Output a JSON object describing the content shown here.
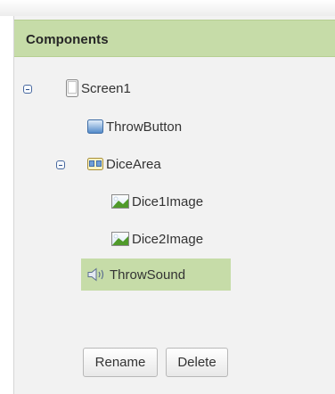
{
  "panel": {
    "title": "Components"
  },
  "tree": {
    "screen": {
      "label": "Screen1",
      "icon": "screen-icon",
      "expanded": true
    },
    "throw_button": {
      "label": "ThrowButton",
      "icon": "button-icon"
    },
    "dice_area": {
      "label": "DiceArea",
      "icon": "arrangement-icon",
      "expanded": true
    },
    "dice1_image": {
      "label": "Dice1Image",
      "icon": "image-icon"
    },
    "dice2_image": {
      "label": "Dice2Image",
      "icon": "image-icon"
    },
    "throw_sound": {
      "label": "ThrowSound",
      "icon": "sound-icon",
      "selected": true
    }
  },
  "actions": {
    "rename_label": "Rename",
    "delete_label": "Delete"
  },
  "colors": {
    "header_bg": "#c6dca8",
    "selection_bg": "#c6dca8",
    "panel_bg": "#f2f2f2"
  }
}
